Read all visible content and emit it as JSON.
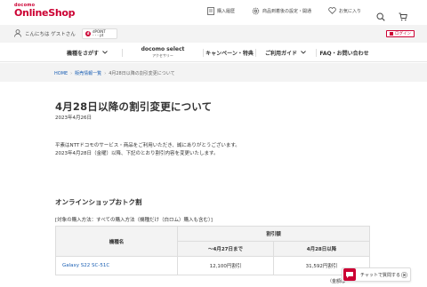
{
  "header": {
    "logo_small": "docomo",
    "logo_big": "OnlineShop",
    "nav": [
      {
        "label": "購入履歴"
      },
      {
        "label": "商品到着後の設定・開通"
      },
      {
        "label": "お気に入り"
      }
    ]
  },
  "user_bar": {
    "greeting": "こんにちは ゲストさん",
    "dpoint_label": "dPOINT",
    "dpoint_value": "- - - pt",
    "login_label": "ログイン"
  },
  "main_nav": {
    "items": [
      {
        "label": "機種をさがす"
      },
      {
        "label": "docomo select",
        "sub": "アクセサリー"
      },
      {
        "label": "キャンペーン・特典"
      },
      {
        "label": "ご利用ガイド"
      },
      {
        "label": "FAQ・お問い合わせ"
      }
    ]
  },
  "breadcrumb": {
    "home": "HOME",
    "list": "販売情報一覧",
    "current": "4月28日以降の割引変更について"
  },
  "article": {
    "title": "4月28日以降の割引変更について",
    "date": "2023年4月26日",
    "paragraphs": [
      "平素はNTTドコモのサービス・商品をご利用いただき、誠にありがとうございます。",
      "2023年4月28日（金曜）以降、下記のとおり割引内容を変更いたします。"
    ],
    "section_title": "オンラインショップおトク割",
    "condition": "[対象の購入方法：すべての購入方法（機種だけ（白ロム）購入も含む）]"
  },
  "discount_table": {
    "col_model": "機種名",
    "col_discount": "割引額",
    "col_before": "〜4月27日まで",
    "col_after": "4月28日以降",
    "rows": [
      {
        "model": "Galaxy S22 SC-51C",
        "before": "12,100円割引",
        "after": "31,592円割引"
      }
    ]
  },
  "chat": {
    "label": "チャットで質問する"
  },
  "footnote": "（金額は",
  "colors": {
    "brand": "#cc0033",
    "link": "#1a5fb4"
  }
}
